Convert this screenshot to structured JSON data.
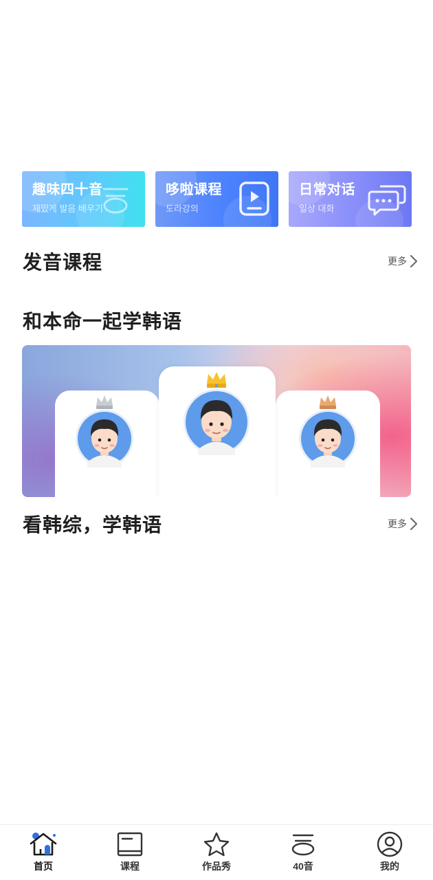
{
  "feature_cards": [
    {
      "title": "趣味四十音",
      "subtitle": "재밌게 발음 배우기"
    },
    {
      "title": "哆啦课程",
      "subtitle": "도라강의"
    },
    {
      "title": "日常对话",
      "subtitle": "일상 대화"
    }
  ],
  "sections": {
    "pronunciation": {
      "title": "发音课程",
      "more": "更多"
    },
    "learn_with": {
      "title": "和本命一起学韩语"
    },
    "variety": {
      "title": "看韩综，学韩语",
      "more": "更多"
    }
  },
  "bottom_nav": [
    {
      "label": "首页",
      "icon": "home-icon",
      "active": true
    },
    {
      "label": "课程",
      "icon": "book-icon"
    },
    {
      "label": "作品秀",
      "icon": "star-icon"
    },
    {
      "label": "40音",
      "icon": "hangul-icon"
    },
    {
      "label": "我的",
      "icon": "profile-icon"
    }
  ],
  "colors": {
    "card1": "#5fc9fb",
    "card2": "#4f84ff",
    "card3": "#8b90fb",
    "nav_accent": "#2f6fe0"
  }
}
